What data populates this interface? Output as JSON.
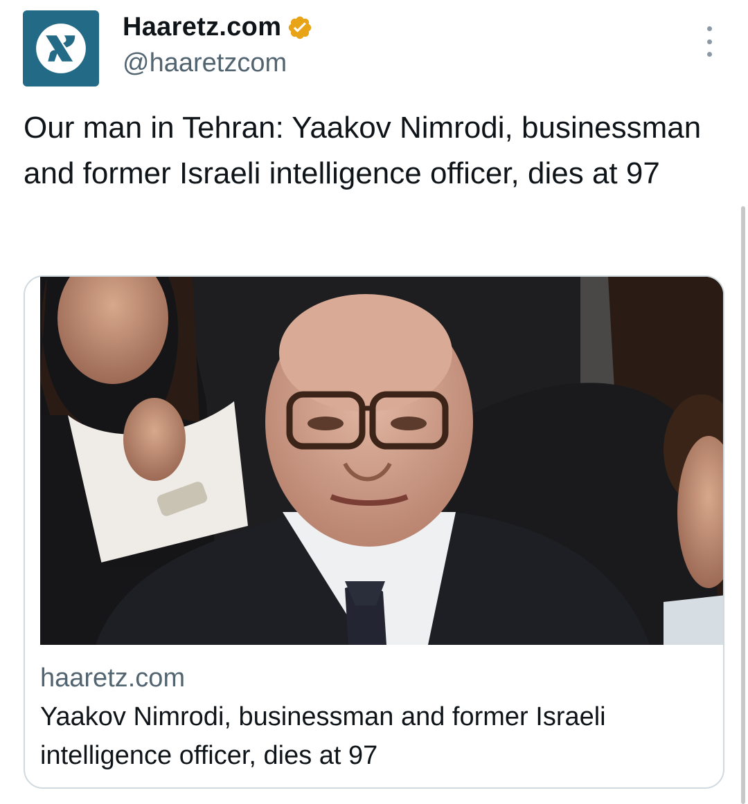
{
  "author": {
    "display_name": "Haaretz.com",
    "handle": "@haaretzcom",
    "avatar_icon": "haaretz-logo-icon",
    "verified_icon": "verified-badge-icon",
    "verified_color": "#e8a317",
    "brand_color": "#226a85"
  },
  "more_icon": "more-options-icon",
  "tweet": {
    "text": "Our man in Tehran: Yaakov Nimrodi, businessman and former Israeli intelligence officer, dies at 97"
  },
  "link_card": {
    "image_icon": "article-photo",
    "domain": "haaretz.com",
    "title": "Yaakov Nimrodi, businessman and former Israeli intelligence officer, dies at 97"
  }
}
